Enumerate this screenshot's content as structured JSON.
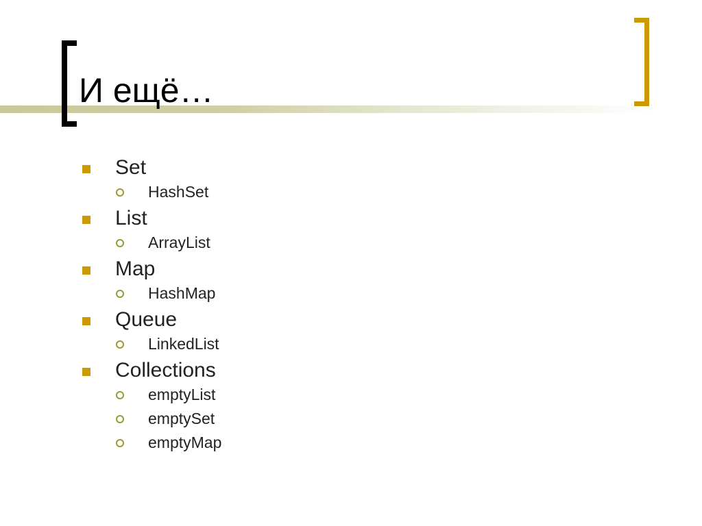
{
  "slide": {
    "title": "И ещё…",
    "colors": {
      "accent": "#cc9900",
      "rule": "#c8c89a",
      "sub_bullet": "#999933"
    },
    "items": [
      {
        "label": "Set",
        "children": [
          "HashSet"
        ]
      },
      {
        "label": "List",
        "children": [
          "ArrayList"
        ]
      },
      {
        "label": "Map",
        "children": [
          "HashMap"
        ]
      },
      {
        "label": "Queue",
        "children": [
          "LinkedList"
        ]
      },
      {
        "label": "Collections",
        "children": [
          "emptyList",
          "emptySet",
          "emptyMap"
        ]
      }
    ]
  }
}
